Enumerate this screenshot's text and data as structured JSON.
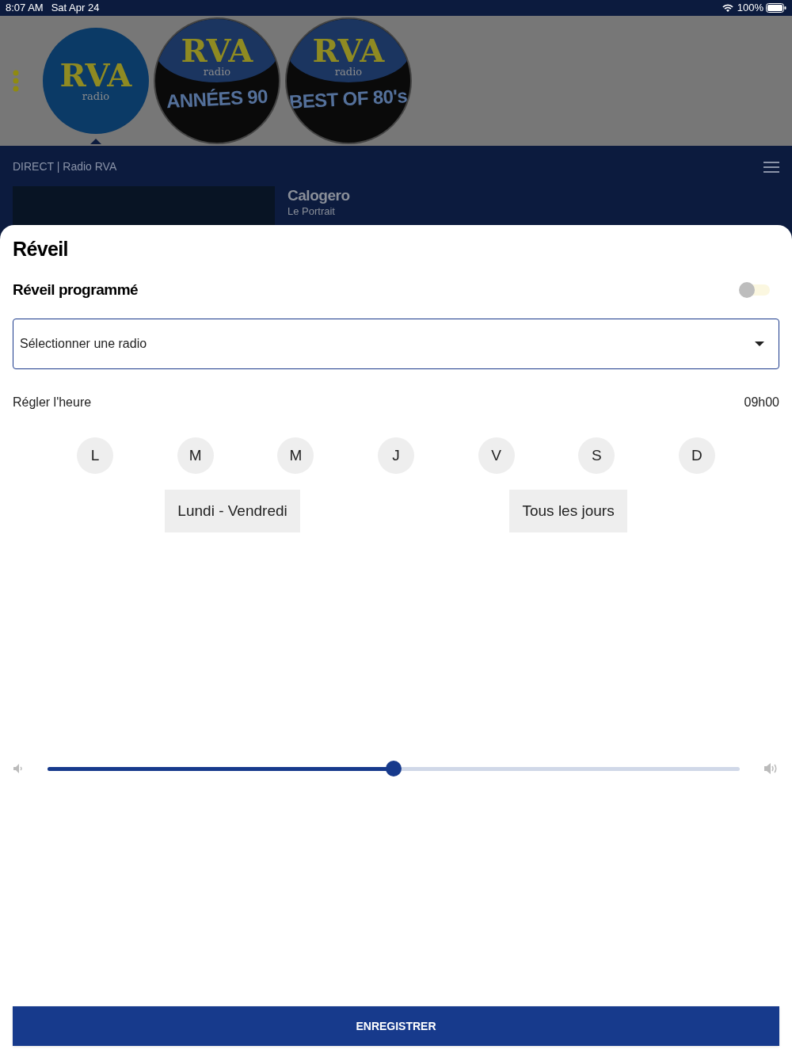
{
  "status_bar": {
    "time": "8:07 AM",
    "date": "Sat Apr 24",
    "battery": "100%"
  },
  "stations": [
    {
      "brand": "RVA",
      "sub": "radio",
      "selected": true
    },
    {
      "brand": "RVA",
      "sub": "radio",
      "name": "ANNÉES 90",
      "selected": false
    },
    {
      "brand": "RVA",
      "sub": "radio",
      "name": "BEST OF 80's",
      "selected": false
    }
  ],
  "player": {
    "title": "DIRECT | Radio RVA",
    "artist": "Calogero",
    "track": "Le Portrait"
  },
  "sheet": {
    "title": "Réveil",
    "alarm_label": "Réveil programmé",
    "alarm_on": false,
    "radio_select": {
      "placeholder": "Sélectionner une radio"
    },
    "time_label": "Régler l'heure",
    "time_value": "09h00",
    "days": [
      {
        "label": "L",
        "selected": false
      },
      {
        "label": "M",
        "selected": false
      },
      {
        "label": "M",
        "selected": false
      },
      {
        "label": "J",
        "selected": false
      },
      {
        "label": "V",
        "selected": false
      },
      {
        "label": "S",
        "selected": false
      },
      {
        "label": "D",
        "selected": false
      }
    ],
    "presets": [
      "Lundi - Vendredi",
      "Tous les jours"
    ],
    "volume": {
      "level": 0.5
    },
    "save": "ENREGISTRER"
  }
}
